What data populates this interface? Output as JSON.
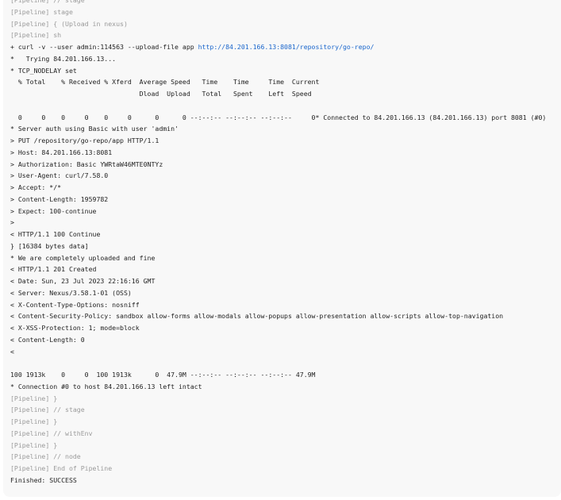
{
  "colors": {
    "panel_background": "#f8f8f8",
    "text": "#222222",
    "pipeline_text": "#9a9a9a",
    "link": "#1a66cc"
  },
  "console": {
    "lines": [
      {
        "kind": "pipeline",
        "text": "[Pipeline] // stage"
      },
      {
        "kind": "pipeline",
        "text": "[Pipeline] stage"
      },
      {
        "kind": "pipeline",
        "text": "[Pipeline] { (Upload in nexus)"
      },
      {
        "kind": "pipeline",
        "text": "[Pipeline] sh"
      },
      {
        "kind": "command",
        "text": "+ curl -v --user admin:114563 --upload-file app ",
        "link": "http://84.201.166.13:8081/repository/go-repo/"
      },
      {
        "kind": "output",
        "text": "*   Trying 84.201.166.13..."
      },
      {
        "kind": "output",
        "text": "* TCP_NODELAY set"
      },
      {
        "kind": "output",
        "text": "  % Total    % Received % Xferd  Average Speed   Time    Time     Time  Current"
      },
      {
        "kind": "output",
        "text": "                                 Dload  Upload   Total   Spent    Left  Speed"
      },
      {
        "kind": "output",
        "text": ""
      },
      {
        "kind": "output",
        "text": "  0     0    0     0    0     0      0      0 --:--:-- --:--:-- --:--:--     0* Connected to 84.201.166.13 (84.201.166.13) port 8081 (#0)"
      },
      {
        "kind": "output",
        "text": "* Server auth using Basic with user 'admin'"
      },
      {
        "kind": "output",
        "text": "> PUT /repository/go-repo/app HTTP/1.1"
      },
      {
        "kind": "output",
        "text": "> Host: 84.201.166.13:8081"
      },
      {
        "kind": "output",
        "text": "> Authorization: Basic YWRtaW46MTE0NTYz"
      },
      {
        "kind": "output",
        "text": "> User-Agent: curl/7.58.0"
      },
      {
        "kind": "output",
        "text": "> Accept: */*"
      },
      {
        "kind": "output",
        "text": "> Content-Length: 1959782"
      },
      {
        "kind": "output",
        "text": "> Expect: 100-continue"
      },
      {
        "kind": "output",
        "text": ">"
      },
      {
        "kind": "output",
        "text": "< HTTP/1.1 100 Continue"
      },
      {
        "kind": "output",
        "text": "} [16384 bytes data]"
      },
      {
        "kind": "output",
        "text": "* We are completely uploaded and fine"
      },
      {
        "kind": "output",
        "text": "< HTTP/1.1 201 Created"
      },
      {
        "kind": "output",
        "text": "< Date: Sun, 23 Jul 2023 22:16:16 GMT"
      },
      {
        "kind": "output",
        "text": "< Server: Nexus/3.58.1-01 (OSS)"
      },
      {
        "kind": "output",
        "text": "< X-Content-Type-Options: nosniff"
      },
      {
        "kind": "output",
        "text": "< Content-Security-Policy: sandbox allow-forms allow-modals allow-popups allow-presentation allow-scripts allow-top-navigation"
      },
      {
        "kind": "output",
        "text": "< X-XSS-Protection: 1; mode=block"
      },
      {
        "kind": "output",
        "text": "< Content-Length: 0"
      },
      {
        "kind": "output",
        "text": "<"
      },
      {
        "kind": "output",
        "text": ""
      },
      {
        "kind": "output",
        "text": "100 1913k    0     0  100 1913k      0  47.9M --:--:-- --:--:-- --:--:-- 47.9M"
      },
      {
        "kind": "output",
        "text": "* Connection #0 to host 84.201.166.13 left intact"
      },
      {
        "kind": "pipeline",
        "text": "[Pipeline] }"
      },
      {
        "kind": "pipeline",
        "text": "[Pipeline] // stage"
      },
      {
        "kind": "pipeline",
        "text": "[Pipeline] }"
      },
      {
        "kind": "pipeline",
        "text": "[Pipeline] // withEnv"
      },
      {
        "kind": "pipeline",
        "text": "[Pipeline] }"
      },
      {
        "kind": "pipeline",
        "text": "[Pipeline] // node"
      },
      {
        "kind": "pipeline",
        "text": "[Pipeline] End of Pipeline"
      },
      {
        "kind": "output",
        "text": "Finished: SUCCESS"
      }
    ]
  }
}
